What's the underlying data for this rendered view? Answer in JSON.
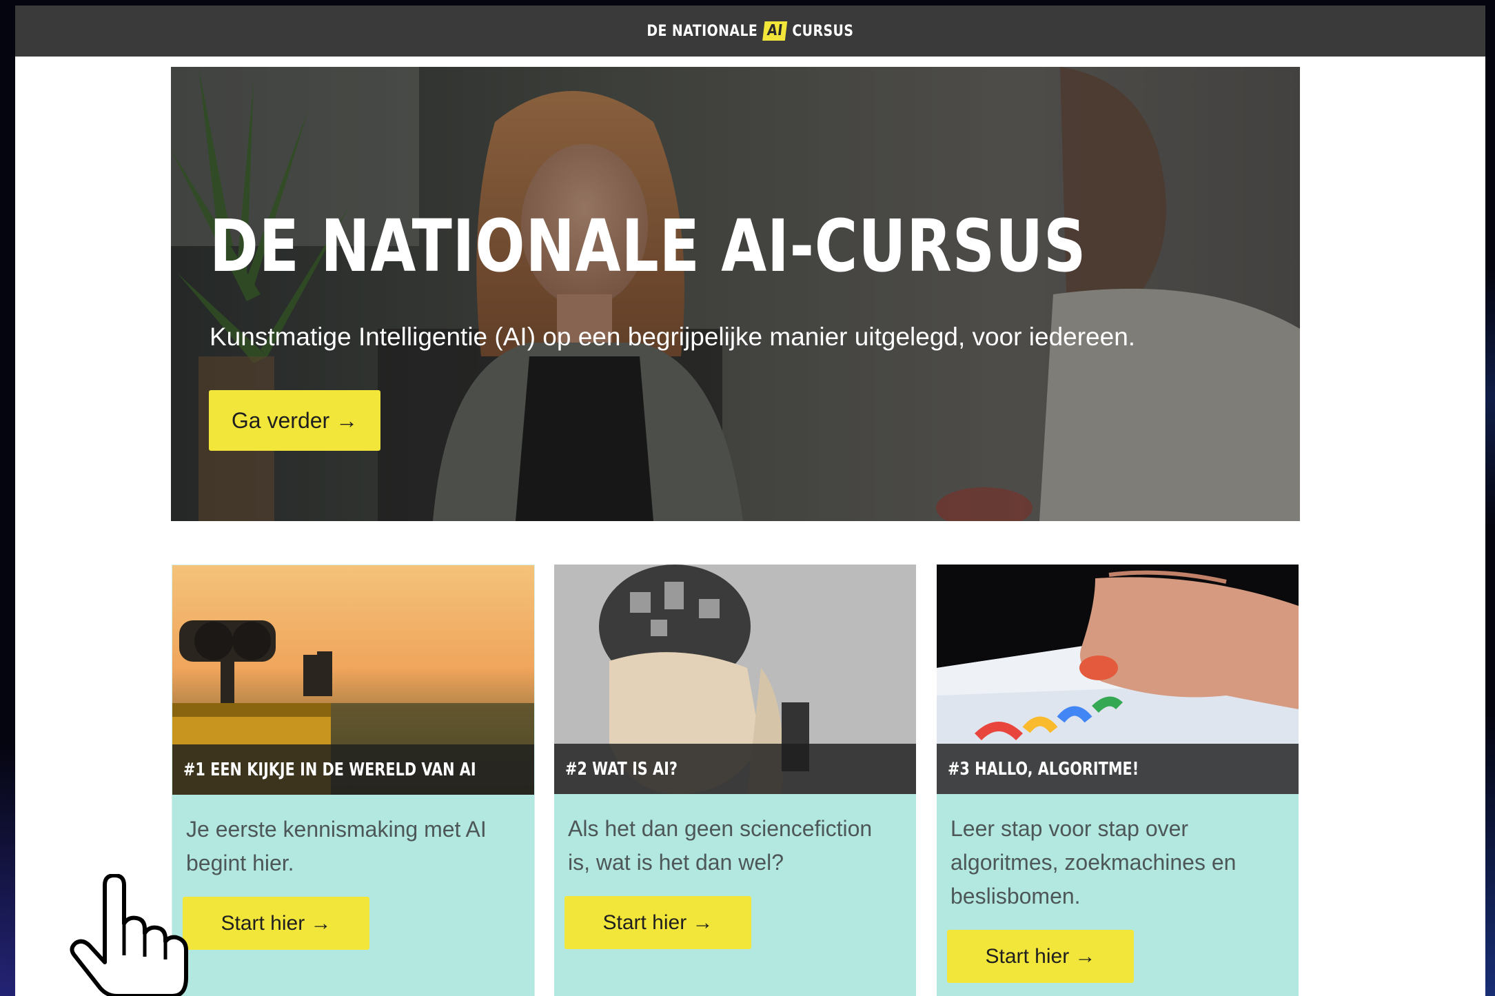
{
  "topbar": {
    "brand_left": "DE NATIONALE",
    "brand_badge": "AI",
    "brand_right": "CURSUS"
  },
  "hero": {
    "title": "DE NATIONALE AI-CURSUS",
    "subtitle": "Kunstmatige Intelligentie (AI) op een begrijpelijke manier uitgelegd, voor iedereen.",
    "button_label": "Ga verder →"
  },
  "cards": [
    {
      "caption": "#1 EEN KIJKJE IN DE WERELD VAN AI",
      "text": "Je eerste kennismaking met AI begint hier.",
      "button_label": "Start hier →"
    },
    {
      "caption": "#2 WAT IS AI?",
      "text": "Als het dan geen sciencefiction is, wat is het dan wel?",
      "button_label": "Start hier →"
    },
    {
      "caption": "#3 HALLO, ALGORITME!",
      "text": "Leer stap voor stap over algoritmes, zoekmachines en beslisbomen.",
      "button_label": "Start hier →"
    }
  ],
  "icons": {
    "cursor": "hand-pointer-icon"
  },
  "colors": {
    "topbar": "#3a3a3a",
    "accent_yellow": "#f2e63a",
    "card_background": "#b3e8e1",
    "caption_background": "#1e1e1e",
    "card_text": "#4d5757"
  }
}
